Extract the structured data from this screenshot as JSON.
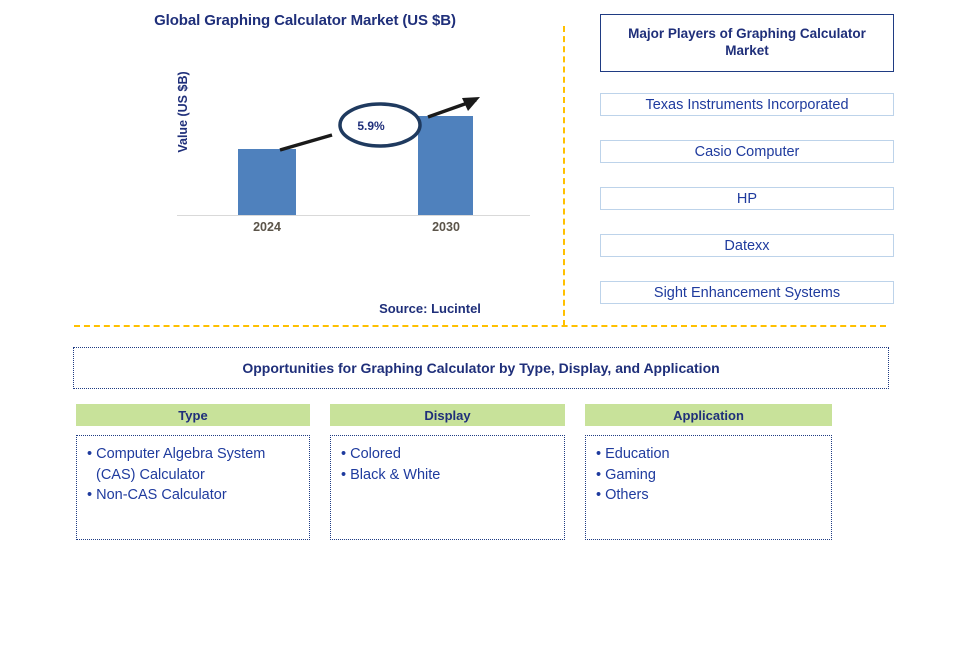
{
  "chart_data": {
    "type": "bar",
    "title": "Global Graphing Calculator Market (US $B)",
    "categories": [
      "2024",
      "2030"
    ],
    "values": [
      66,
      99
    ],
    "xlabel": "",
    "ylabel": "Value (US $B)",
    "grid": false,
    "legend": "none",
    "annotations": [
      {
        "label": "5.9%",
        "type": "cagr-callout",
        "from": "2024",
        "to": "2030"
      }
    ],
    "bar_color": "#4f81bd",
    "axis_color": "#d9d9d9",
    "tick_label_color": "#5b5449"
  },
  "chart": {
    "title": "Global Graphing Calculator Market (US $B)",
    "y_axis_label": "Value (US $B)",
    "cagr_label": "5.9%",
    "ticks": [
      "2024",
      "2030"
    ],
    "source": "Source: Lucintel"
  },
  "players": {
    "header": "Major Players of Graphing Calculator Market",
    "items": [
      "Texas Instruments Incorporated",
      "Casio Computer",
      "HP",
      "Datexx",
      "Sight Enhancement Systems"
    ]
  },
  "opportunities": {
    "banner": "Opportunities for Graphing Calculator by Type, Display, and Application",
    "columns": [
      {
        "header": "Type",
        "items": [
          "Computer Algebra System (CAS) Calculator",
          "Non-CAS Calculator"
        ]
      },
      {
        "header": "Display",
        "items": [
          "Colored",
          "Black & White"
        ]
      },
      {
        "header": "Application",
        "items": [
          "Education",
          "Gaming",
          "Others"
        ]
      }
    ]
  },
  "colors": {
    "brand_navy": "#1f2f7a",
    "text_blue": "#1f3b9e",
    "bar_blue": "#4f81bd",
    "divider_orange": "#ffc000",
    "header_green": "#c8e29a",
    "box_border_blue": "#bdd3ea"
  }
}
